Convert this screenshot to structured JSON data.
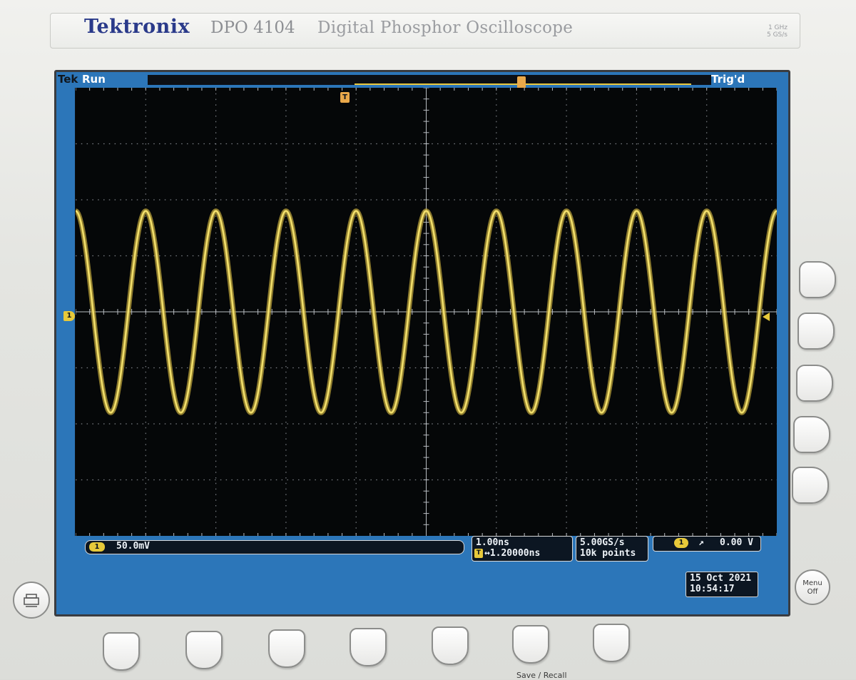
{
  "instrument": {
    "brand": "Tektronix",
    "model": "DPO 4104",
    "description": "Digital Phosphor Oscilloscope",
    "bandwidth": "1 GHz",
    "sample_rate_spec": "5 GS/s"
  },
  "status": {
    "tek": "Tek",
    "acquisition": "Run",
    "trigger_state": "Trig'd"
  },
  "channel1": {
    "badge": "1",
    "scale": "50.0mV"
  },
  "horizontal": {
    "timebase": "1.00ns",
    "delay_icon": "T",
    "delay": "↔1.20000ns"
  },
  "acquisition": {
    "sample_rate": "5.00GS/s",
    "record_length": "10k points"
  },
  "trigger": {
    "source_badge": "1",
    "slope_symbol": "↗",
    "level": "0.00 V",
    "position_marker": "T"
  },
  "datetime": {
    "date": "15 Oct  2021",
    "time": "10:54:17"
  },
  "buttons": {
    "menu_off_line1": "Menu",
    "menu_off_line2": "Off",
    "save_recall": "Save / Recall"
  },
  "colors": {
    "trace": "#f2df6b",
    "trace_glow": "#b9a23a",
    "screen_frame": "#2c76b9",
    "grid": "#8a8f95",
    "brand": "#2a3a8a"
  },
  "chart_data": {
    "type": "line",
    "title": "",
    "xlabel": "",
    "ylabel": "",
    "x_divisions": 10,
    "y_divisions": 8,
    "series": [
      {
        "name": "1",
        "waveform": "sine",
        "cycles_on_screen": 10,
        "amplitude_divisions": 1.8,
        "phase_at_left_edge": "positive peak"
      }
    ],
    "grid": true
  }
}
